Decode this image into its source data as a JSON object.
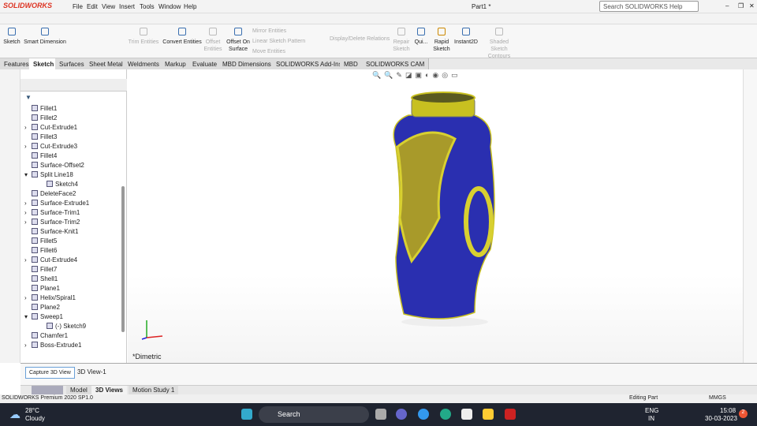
{
  "app": {
    "logo": "SOLIDWORKS",
    "title": "Part1 *",
    "search_placeholder": "Search SOLIDWORKS Help"
  },
  "menu": [
    "File",
    "Edit",
    "View",
    "Insert",
    "Tools",
    "Window",
    "Help"
  ],
  "ribbon": {
    "sketch": "Sketch",
    "smart_dimension": "Smart Dimension",
    "trim": "Trim Entities",
    "convert": "Convert Entities",
    "offset": "Offset Entities",
    "offset_surface": "Offset On Surface",
    "mirror": "Mirror Entities",
    "linear_pattern": "Linear Sketch Pattern",
    "move": "Move Entities",
    "display_relations": "Display/Delete Relations",
    "repair": "Repair Sketch",
    "quick": "Qui...",
    "rapid": "Rapid Sketch",
    "instant2d": "Instant2D",
    "shaded": "Shaded Sketch Contours"
  },
  "tabs": [
    "Features",
    "Sketch",
    "Surfaces",
    "Sheet Metal",
    "Weldments",
    "Markup",
    "Evaluate",
    "MBD Dimensions",
    "SOLIDWORKS Add-Ins",
    "MBD",
    "SOLIDWORKS CAM"
  ],
  "active_tab": "Sketch",
  "tree": [
    {
      "label": "Fillet1",
      "level": 0
    },
    {
      "label": "Fillet2",
      "level": 0
    },
    {
      "label": "Cut-Extrude1",
      "level": 0,
      "expandable": true
    },
    {
      "label": "Fillet3",
      "level": 0
    },
    {
      "label": "Cut-Extrude3",
      "level": 0,
      "expandable": true
    },
    {
      "label": "Fillet4",
      "level": 0
    },
    {
      "label": "Surface-Offset2",
      "level": 0
    },
    {
      "label": "Split Line18",
      "level": 0,
      "expanded": true
    },
    {
      "label": "Sketch4",
      "level": 1
    },
    {
      "label": "DeleteFace2",
      "level": 0
    },
    {
      "label": "Surface-Extrude1",
      "level": 0,
      "expandable": true
    },
    {
      "label": "Surface-Trim1",
      "level": 0,
      "expandable": true
    },
    {
      "label": "Surface-Trim2",
      "level": 0,
      "expandable": true
    },
    {
      "label": "Surface-Knit1",
      "level": 0
    },
    {
      "label": "Fillet5",
      "level": 0
    },
    {
      "label": "Fillet6",
      "level": 0
    },
    {
      "label": "Cut-Extrude4",
      "level": 0,
      "expandable": true
    },
    {
      "label": "Fillet7",
      "level": 0
    },
    {
      "label": "Shell1",
      "level": 0
    },
    {
      "label": "Plane1",
      "level": 0
    },
    {
      "label": "Helix/Spiral1",
      "level": 0,
      "expandable": true
    },
    {
      "label": "Plane2",
      "level": 0
    },
    {
      "label": "Sweep1",
      "level": 0,
      "expanded": true
    },
    {
      "label": "(-) Sketch9",
      "level": 1
    },
    {
      "label": "Chamfer1",
      "level": 0
    },
    {
      "label": "Boss-Extrude1",
      "level": 0,
      "expandable": true
    }
  ],
  "viewport": {
    "view_name": "*Dimetric",
    "body_color": "#2a2fb0",
    "accent_color": "#c8c020"
  },
  "bottom": {
    "capture": "Capture 3D View",
    "view": "3D View-1",
    "tabs": [
      "Model",
      "3D Views",
      "Motion Study 1"
    ],
    "active": "3D Views"
  },
  "status": {
    "product": "SOLIDWORKS Premium 2020 SP1.0",
    "mode": "Editing Part",
    "units": "MMGS"
  },
  "taskbar": {
    "temp": "28°C",
    "weather": "Cloudy",
    "search": "Search",
    "lang": "ENG",
    "region": "IN",
    "time": "15:08",
    "date": "30-03-2023",
    "badge": "2"
  }
}
